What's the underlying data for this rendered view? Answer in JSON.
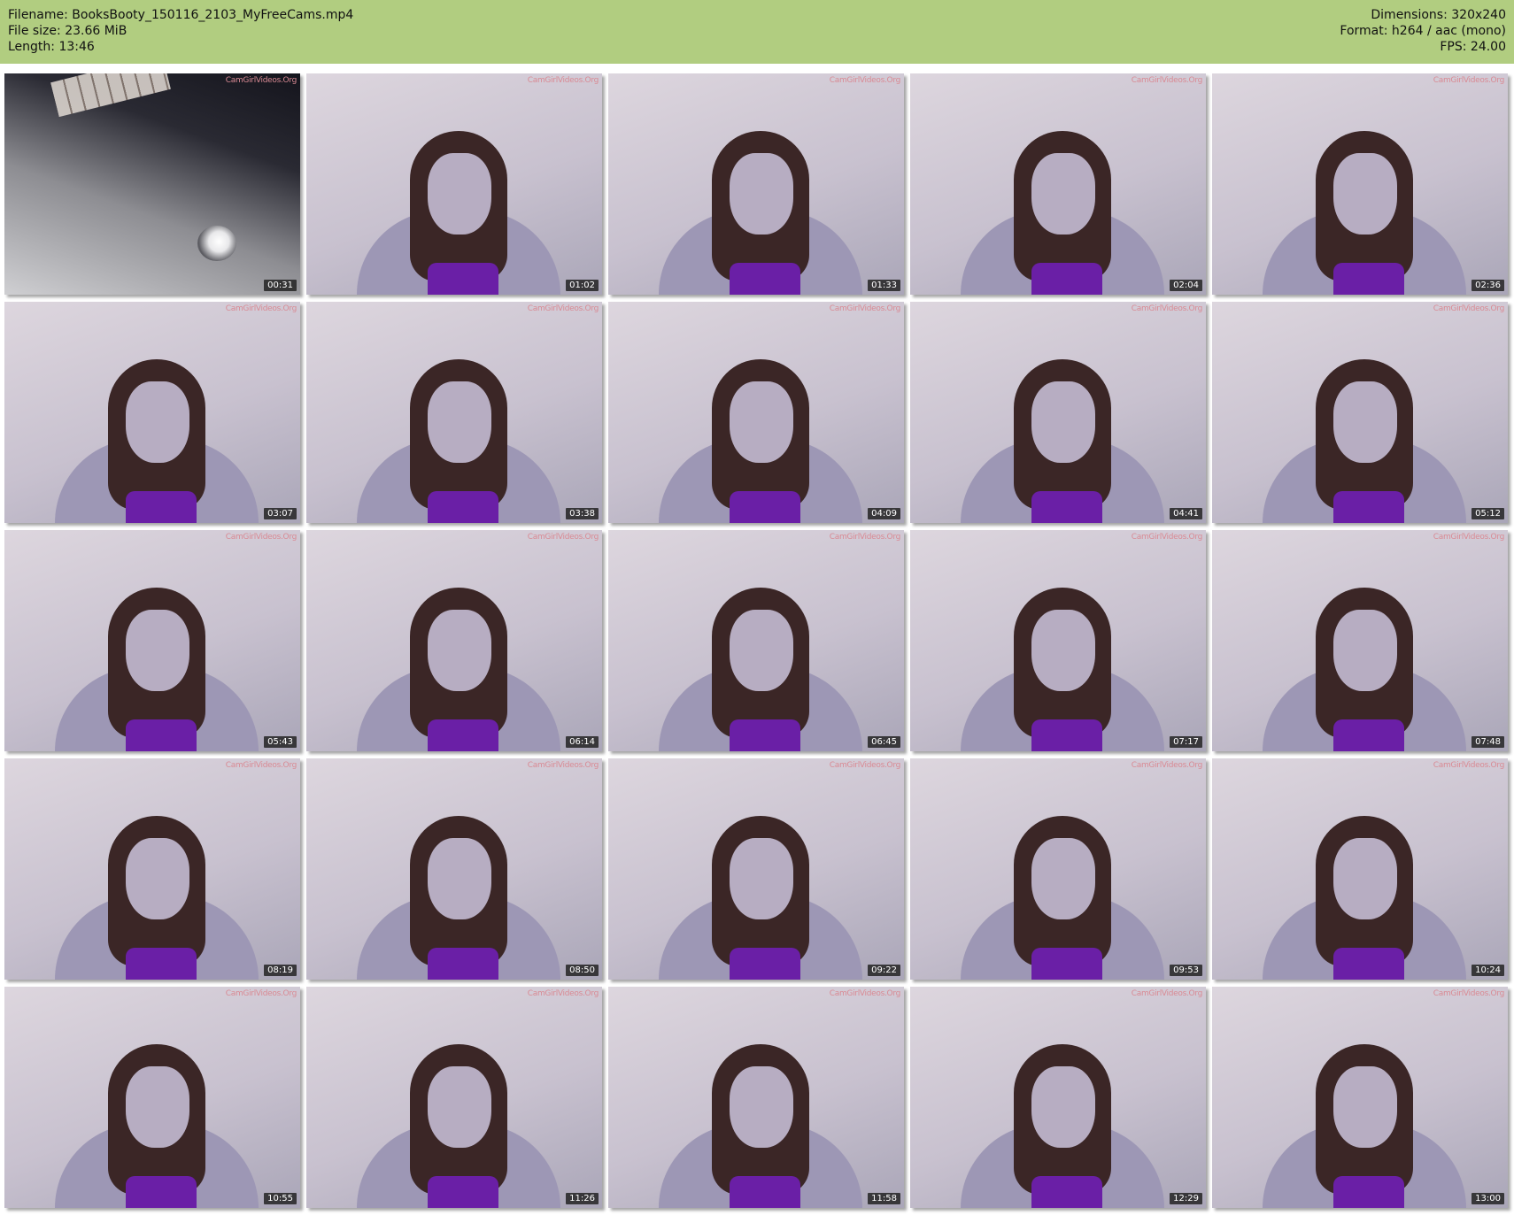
{
  "meta": {
    "filename": "Filename: BooksBooty_150116_2103_MyFreeCams.mp4",
    "filesize": "File size: 23.66 MiB",
    "length": "Length: 13:46",
    "dimensions": "Dimensions: 320x240",
    "format": "Format: h264 / aac (mono)",
    "fps": "FPS: 24.00"
  },
  "watermark": "CamGirlVideos.Org",
  "thumbnails": [
    {
      "time": "00:31",
      "variant": "dark"
    },
    {
      "time": "01:02"
    },
    {
      "time": "01:33"
    },
    {
      "time": "02:04"
    },
    {
      "time": "02:36"
    },
    {
      "time": "03:07"
    },
    {
      "time": "03:38"
    },
    {
      "time": "04:09"
    },
    {
      "time": "04:41"
    },
    {
      "time": "05:12"
    },
    {
      "time": "05:43"
    },
    {
      "time": "06:14"
    },
    {
      "time": "06:45"
    },
    {
      "time": "07:17"
    },
    {
      "time": "07:48"
    },
    {
      "time": "08:19"
    },
    {
      "time": "08:50"
    },
    {
      "time": "09:22"
    },
    {
      "time": "09:53"
    },
    {
      "time": "10:24"
    },
    {
      "time": "10:55"
    },
    {
      "time": "11:26"
    },
    {
      "time": "11:58"
    },
    {
      "time": "12:29"
    },
    {
      "time": "13:00"
    }
  ],
  "colors": {
    "header_bg": "#b1cd80",
    "stamp_bg": "#232323",
    "watermark": "#d98a94"
  }
}
